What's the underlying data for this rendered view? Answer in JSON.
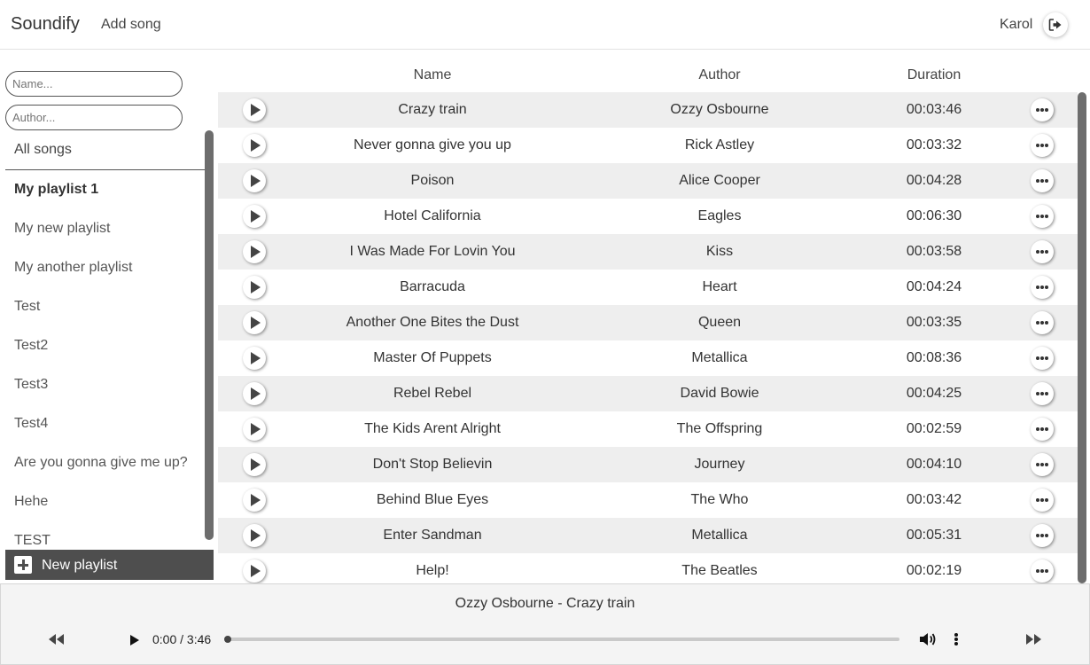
{
  "header": {
    "brand": "Soundify",
    "add_song": "Add song",
    "user": "Karol",
    "logout_icon": "sign-out-icon"
  },
  "sidebar": {
    "name_placeholder": "Name...",
    "author_placeholder": "Author...",
    "all_songs": "All songs",
    "playlists": [
      {
        "label": "My playlist 1",
        "active": true
      },
      {
        "label": "My new playlist"
      },
      {
        "label": "My another playlist"
      },
      {
        "label": "Test"
      },
      {
        "label": "Test2"
      },
      {
        "label": "Test3"
      },
      {
        "label": "Test4"
      },
      {
        "label": "Are you gonna give me up?"
      },
      {
        "label": "Hehe"
      },
      {
        "label": "TEST"
      }
    ],
    "new_playlist": "New playlist"
  },
  "table": {
    "headers": {
      "name": "Name",
      "author": "Author",
      "duration": "Duration"
    },
    "songs": [
      {
        "name": "Crazy train",
        "author": "Ozzy Osbourne",
        "duration": "00:03:46"
      },
      {
        "name": "Never gonna give you up",
        "author": "Rick Astley",
        "duration": "00:03:32"
      },
      {
        "name": "Poison",
        "author": "Alice Cooper",
        "duration": "00:04:28"
      },
      {
        "name": "Hotel California",
        "author": "Eagles",
        "duration": "00:06:30"
      },
      {
        "name": "I Was Made For Lovin You",
        "author": "Kiss",
        "duration": "00:03:58"
      },
      {
        "name": "Barracuda",
        "author": "Heart",
        "duration": "00:04:24"
      },
      {
        "name": "Another One Bites the Dust",
        "author": "Queen",
        "duration": "00:03:35"
      },
      {
        "name": "Master Of Puppets",
        "author": "Metallica",
        "duration": "00:08:36"
      },
      {
        "name": "Rebel Rebel",
        "author": "David Bowie",
        "duration": "00:04:25"
      },
      {
        "name": "The Kids Arent Alright",
        "author": "The Offspring",
        "duration": "00:02:59"
      },
      {
        "name": "Don't Stop Believin",
        "author": "Journey",
        "duration": "00:04:10"
      },
      {
        "name": "Behind Blue Eyes",
        "author": "The Who",
        "duration": "00:03:42"
      },
      {
        "name": "Enter Sandman",
        "author": "Metallica",
        "duration": "00:05:31"
      },
      {
        "name": "Help!",
        "author": "The Beatles",
        "duration": "00:02:19"
      }
    ]
  },
  "player": {
    "now_playing": "Ozzy Osbourne - Crazy train",
    "time": "0:00 / 3:46",
    "progress": 0.0
  },
  "colors": {
    "row_alt": "#eeeeee",
    "new_playlist_bg": "#4e4e4e",
    "scrollbar": "#6d6d6d"
  }
}
